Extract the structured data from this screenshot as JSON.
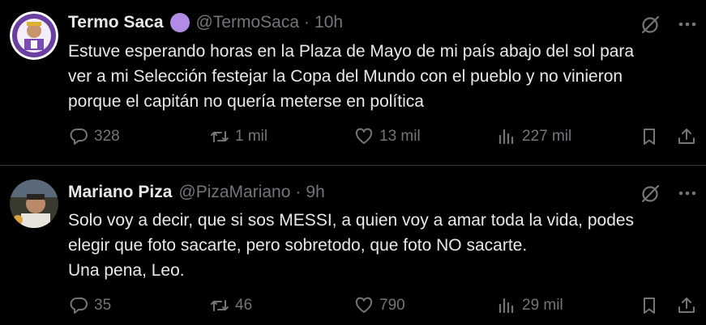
{
  "tweets": [
    {
      "name": "Termo Saca",
      "handle": "@TermoSaca",
      "dot": "·",
      "time": "10h",
      "text_lines": [
        "Estuve esperando horas en la Plaza de Mayo de mi país abajo del sol para",
        "ver a mi Selección festejar la Copa del Mundo con el pueblo y no vinieron",
        "porque el capitán no quería meterse en política"
      ],
      "replies": "328",
      "retweets": "1 mil",
      "likes": "13 mil",
      "views": "227 mil",
      "badge_color": "#b18be6"
    },
    {
      "name": "Mariano Piza",
      "handle": "@PizaMariano",
      "dot": "·",
      "time": "9h",
      "text_lines": [
        "Solo voy a decir, que si sos MESSI, a quien voy a amar toda la vida, podes",
        "elegir que foto sacarte, pero sobretodo, que foto NO sacarte.",
        "Una pena, Leo."
      ],
      "replies": "35",
      "retweets": "46",
      "likes": "790",
      "views": "29 mil"
    }
  ],
  "icons": {
    "reply": "speech-bubble",
    "retweet": "retweet-arrows",
    "like": "heart",
    "views": "bar-chart",
    "bookmark": "bookmark",
    "share": "share-upload",
    "grok": "slashed-circle",
    "more": "ellipsis"
  },
  "colors": {
    "background": "#000000",
    "text": "#e7e9ea",
    "muted": "#71767b",
    "divider": "#2f3336"
  }
}
